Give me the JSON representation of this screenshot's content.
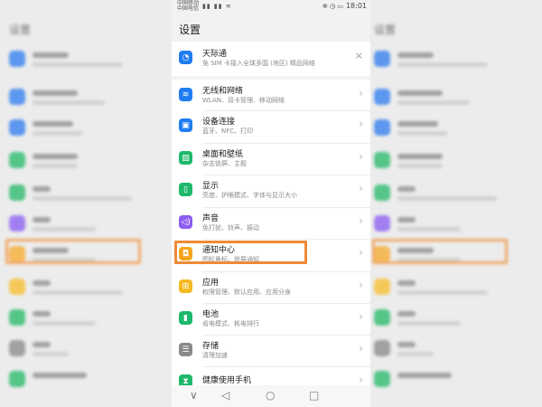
{
  "status_bar": {
    "carrier_1": "中国移动",
    "carrier_2": "中国电信",
    "signal_icons": "▮▮ ▮▮ ≋",
    "right_icons": "✲ ◷ ▭",
    "time": "18:01"
  },
  "page": {
    "title": "设置"
  },
  "items": [
    {
      "title": "天际通",
      "subtitle": "免 SIM 卡接入全球多国 (地区) 精品网络",
      "icon": "globe-icon",
      "color": "#1f7cf1",
      "glyph": "◔",
      "trail": "×"
    },
    {
      "title": "无线和网络",
      "subtitle": "WLAN、双卡管理、移动网络",
      "icon": "wifi-icon",
      "color": "#1f7cf1",
      "glyph": "≋",
      "trail": "›"
    },
    {
      "title": "设备连接",
      "subtitle": "蓝牙、NFC、打印",
      "icon": "device-connection-icon",
      "color": "#1f7cf1",
      "glyph": "▣",
      "trail": "›"
    },
    {
      "title": "桌面和壁纸",
      "subtitle": "杂志锁屏、主题",
      "icon": "wallpaper-icon",
      "color": "#1db86b",
      "glyph": "▨",
      "trail": "›"
    },
    {
      "title": "显示",
      "subtitle": "亮度、护眼模式、字体与显示大小",
      "icon": "display-icon",
      "color": "#1db86b",
      "glyph": "▯",
      "trail": "›"
    },
    {
      "title": "声音",
      "subtitle": "免打扰、铃声、振动",
      "icon": "sound-icon",
      "color": "#8c5cf0",
      "glyph": "◁)",
      "trail": "›"
    },
    {
      "title": "通知中心",
      "subtitle": "图标角标、锁屏通知",
      "icon": "notification-icon",
      "color": "#f5a51c",
      "glyph": "◘",
      "trail": "›"
    },
    {
      "title": "应用",
      "subtitle": "权限管理、默认应用、应用分身",
      "icon": "apps-icon",
      "color": "#f5b922",
      "glyph": "⊞",
      "trail": "›"
    },
    {
      "title": "电池",
      "subtitle": "省电模式、耗电排行",
      "icon": "battery-icon",
      "color": "#1db86b",
      "glyph": "▮",
      "trail": "›"
    },
    {
      "title": "存储",
      "subtitle": "清理加速",
      "icon": "storage-icon",
      "color": "#8a8a8a",
      "glyph": "☰",
      "trail": "›"
    },
    {
      "title": "健康使用手机",
      "subtitle": "",
      "icon": "hourglass-icon",
      "color": "#1db86b",
      "glyph": "⧗",
      "trail": "›"
    }
  ],
  "navbar": {
    "menu": "∨",
    "back": "◁",
    "home": "○",
    "recent": "□"
  },
  "side_title": "设置"
}
